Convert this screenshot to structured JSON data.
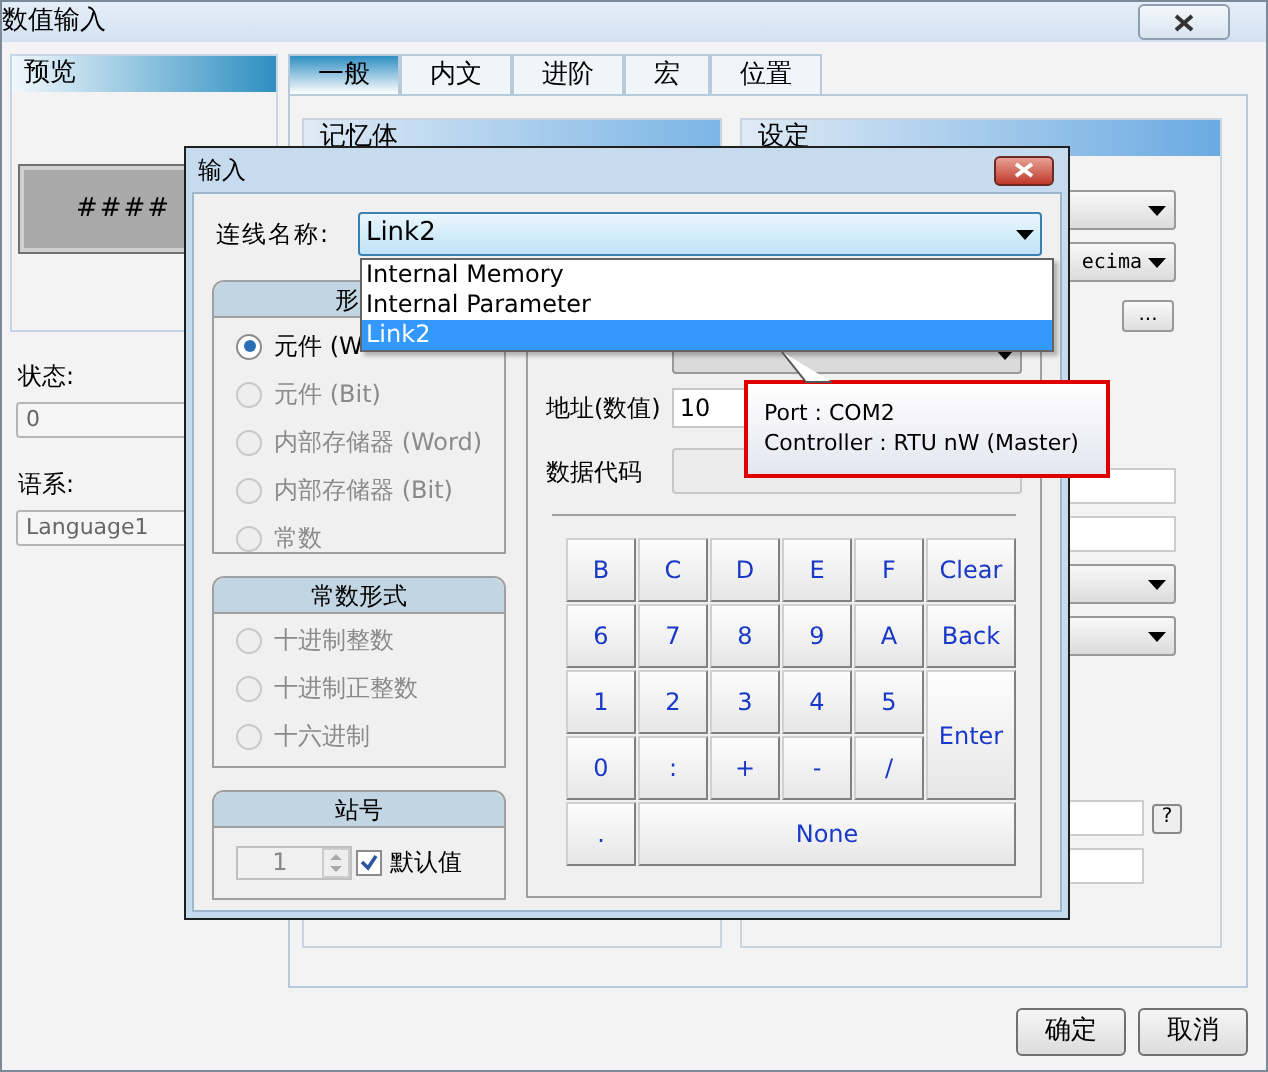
{
  "window": {
    "title": "数值输入"
  },
  "preview": {
    "title": "预览",
    "display": "####",
    "status_label": "状态:",
    "status_value": "0",
    "language_label": "语系:",
    "language_value": "Language1"
  },
  "tabs": [
    {
      "label": "一般",
      "selected": true
    },
    {
      "label": "内文",
      "selected": false
    },
    {
      "label": "进阶",
      "selected": false
    },
    {
      "label": "宏",
      "selected": false
    },
    {
      "label": "位置",
      "selected": false
    }
  ],
  "memory_group": {
    "title": "记忆体"
  },
  "settings_group": {
    "title": "设定",
    "format_value": "ecima",
    "browse_button": "...",
    "help_button": "?"
  },
  "buttons": [
    {
      "label": "确定"
    },
    {
      "label": "取消"
    }
  ],
  "dialog": {
    "title": "输入",
    "link_label": "连线名称:",
    "link_value": "Link2",
    "link_options": [
      {
        "label": "Internal Memory",
        "selected": false
      },
      {
        "label": "Internal Parameter",
        "selected": false
      },
      {
        "label": "Link2",
        "selected": true
      }
    ],
    "type_group": {
      "title": "形",
      "options": [
        {
          "label": "元件 (W",
          "selected": true,
          "disabled": false
        },
        {
          "label": "元件 (Bit)",
          "selected": false,
          "disabled": true
        },
        {
          "label": "内部存储器 (Word)",
          "selected": false,
          "disabled": true
        },
        {
          "label": "内部存储器 (Bit)",
          "selected": false,
          "disabled": true
        },
        {
          "label": "常数",
          "selected": false,
          "disabled": true
        }
      ]
    },
    "constant_group": {
      "title": "常数形式",
      "options": [
        {
          "label": "十进制整数",
          "selected": false,
          "disabled": true
        },
        {
          "label": "十进制正整数",
          "selected": false,
          "disabled": true
        },
        {
          "label": "十六进制",
          "selected": false,
          "disabled": true
        }
      ]
    },
    "station_group": {
      "title": "站号",
      "value": "1",
      "default_label": "默认值",
      "default_checked": true
    },
    "address_label": "地址(数值)",
    "address_value": "10",
    "data_code_label": "数据代码",
    "keys": [
      {
        "label": "B",
        "kind": "normal"
      },
      {
        "label": "C",
        "kind": "normal"
      },
      {
        "label": "D",
        "kind": "normal"
      },
      {
        "label": "E",
        "kind": "normal"
      },
      {
        "label": "F",
        "kind": "normal"
      },
      {
        "label": "Clear",
        "kind": "normal"
      },
      {
        "label": "6",
        "kind": "normal"
      },
      {
        "label": "7",
        "kind": "normal"
      },
      {
        "label": "8",
        "kind": "normal"
      },
      {
        "label": "9",
        "kind": "normal"
      },
      {
        "label": "A",
        "kind": "normal"
      },
      {
        "label": "Back",
        "kind": "normal"
      },
      {
        "label": "1",
        "kind": "normal"
      },
      {
        "label": "2",
        "kind": "normal"
      },
      {
        "label": "3",
        "kind": "normal"
      },
      {
        "label": "4",
        "kind": "normal"
      },
      {
        "label": "5",
        "kind": "normal"
      },
      {
        "label": "Enter",
        "kind": "tall"
      },
      {
        "label": "0",
        "kind": "normal"
      },
      {
        "label": ":",
        "kind": "normal"
      },
      {
        "label": "+",
        "kind": "normal"
      },
      {
        "label": "-",
        "kind": "normal"
      },
      {
        "label": "/",
        "kind": "normal"
      },
      {
        "label": ".",
        "kind": "normal"
      },
      {
        "label": "None",
        "kind": "wide"
      }
    ],
    "tooltip": {
      "lines": [
        "Port : COM2",
        "Controller : RTU nW (Master)"
      ]
    }
  }
}
